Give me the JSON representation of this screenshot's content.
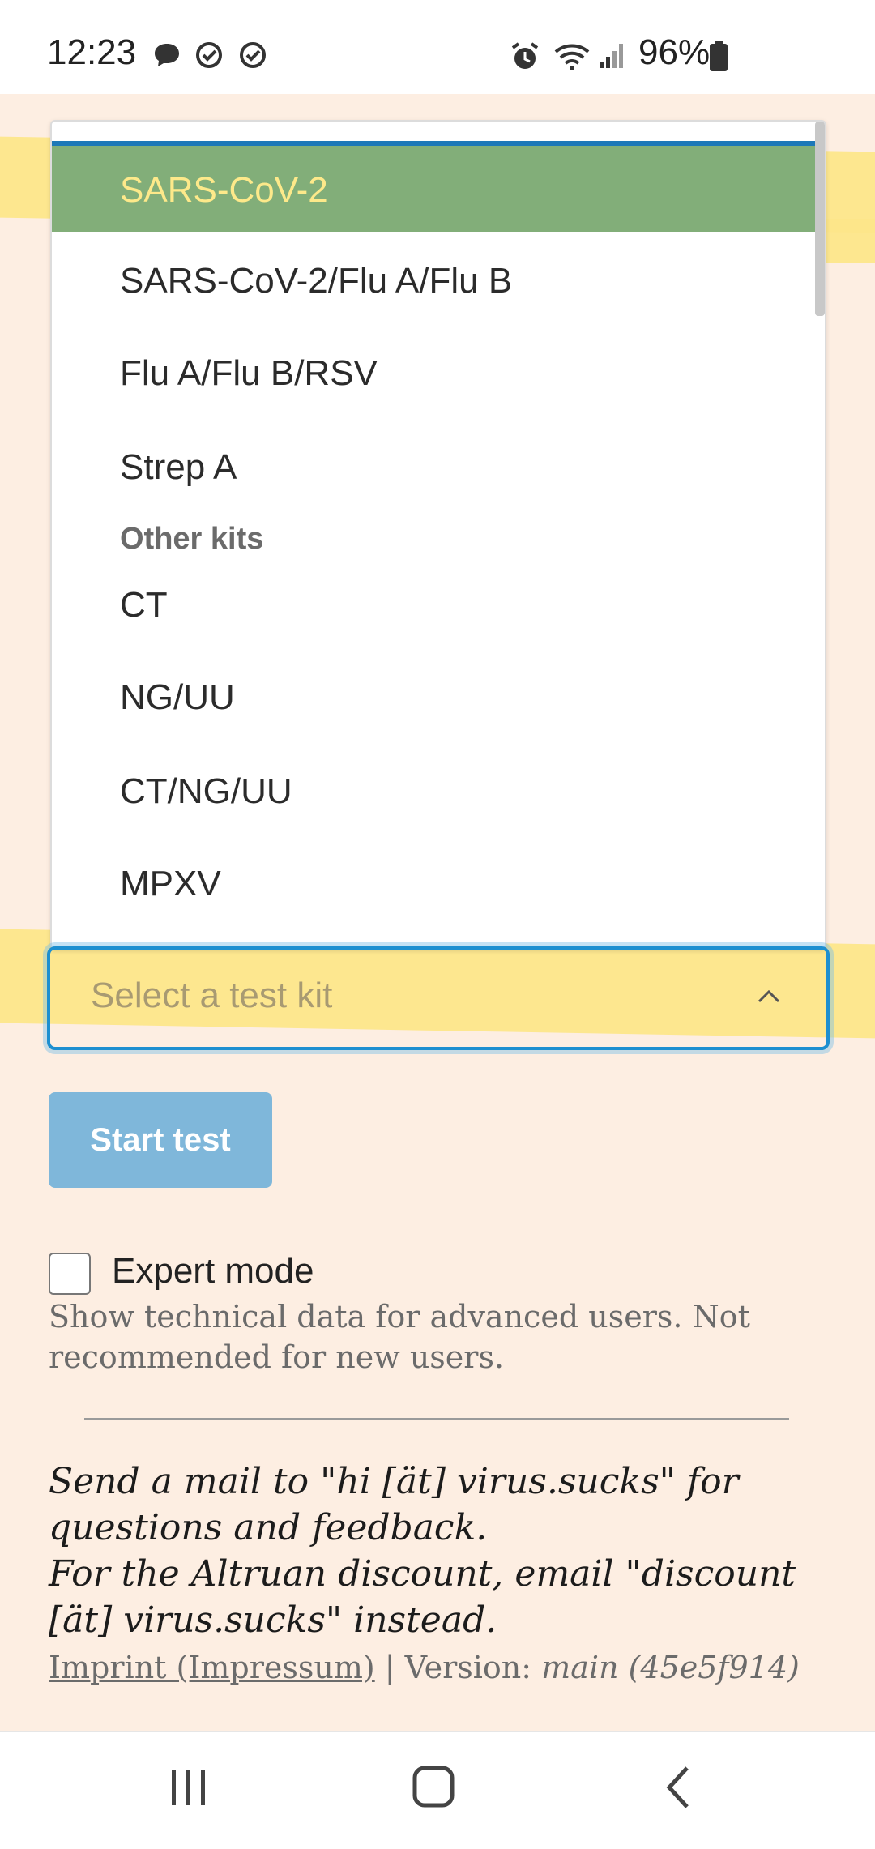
{
  "status_bar": {
    "time": "12:23",
    "battery": "96%",
    "icons": [
      "message-icon",
      "check-circle-icon",
      "check-circle-icon",
      "alarm-icon",
      "wifi-icon",
      "signal-icon",
      "battery-icon"
    ]
  },
  "dropdown": {
    "options": [
      {
        "label": "SARS-CoV-2",
        "selected": true
      },
      {
        "label": "SARS-CoV-2/Flu A/Flu B"
      },
      {
        "label": "Flu A/Flu B/RSV"
      },
      {
        "label": "Strep A"
      }
    ],
    "group_label": "Other kits",
    "group_options": [
      {
        "label": "CT"
      },
      {
        "label": "NG/UU"
      },
      {
        "label": "CT/NG/UU"
      },
      {
        "label": "MPXV"
      }
    ]
  },
  "select": {
    "placeholder": "Select a test kit"
  },
  "start_button": "Start test",
  "expert_mode": {
    "label": "Expert mode",
    "help": "Show technical data for advanced users. Not recommended for new users."
  },
  "contact": {
    "line1": "Send a mail to \"hi [ät] virus.sucks\" for questions and feedback.",
    "line2": "For the Altruan discount, email \"discount [ät] virus.sucks\" instead."
  },
  "footer": {
    "imprint": "Imprint (Impressum)",
    "separator": " | Version: ",
    "version": "main (45e5f914)"
  },
  "colors": {
    "page_bg": "#fdeee2",
    "selected_bg": "#82ae79",
    "accent": "#1d8fd0",
    "highlight": "#fde68a",
    "button_bg": "#7fb7da"
  }
}
